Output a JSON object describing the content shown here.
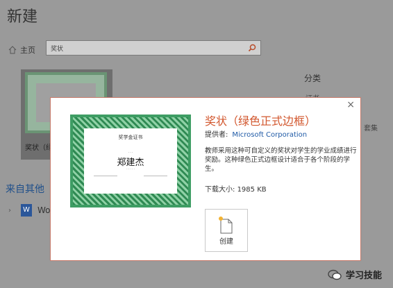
{
  "page": {
    "title": "新建"
  },
  "nav": {
    "home": "主页",
    "search_value": "奖状"
  },
  "template": {
    "label": "奖状（绿"
  },
  "sidebar": {
    "heading": "分类",
    "item1": "证书",
    "extra": "套集"
  },
  "other": {
    "heading": "来自其他",
    "row_label": "Wo"
  },
  "dialog": {
    "title": "奖状（绿色正式边框）",
    "provider_label": "提供者:",
    "provider_link": "Microsoft Corporation",
    "description": "教师采用这种可自定义的奖状对学生的学业成绩进行奖励。这种绿色正式边框设计适合于各个阶段的学生。",
    "download_size_label": "下载大小:",
    "download_size_value": "1985 KB",
    "create_label": "创建"
  },
  "certificate": {
    "title": "奖学金证书",
    "name": "郑建杰"
  },
  "watermark": {
    "label": "学习技能"
  }
}
